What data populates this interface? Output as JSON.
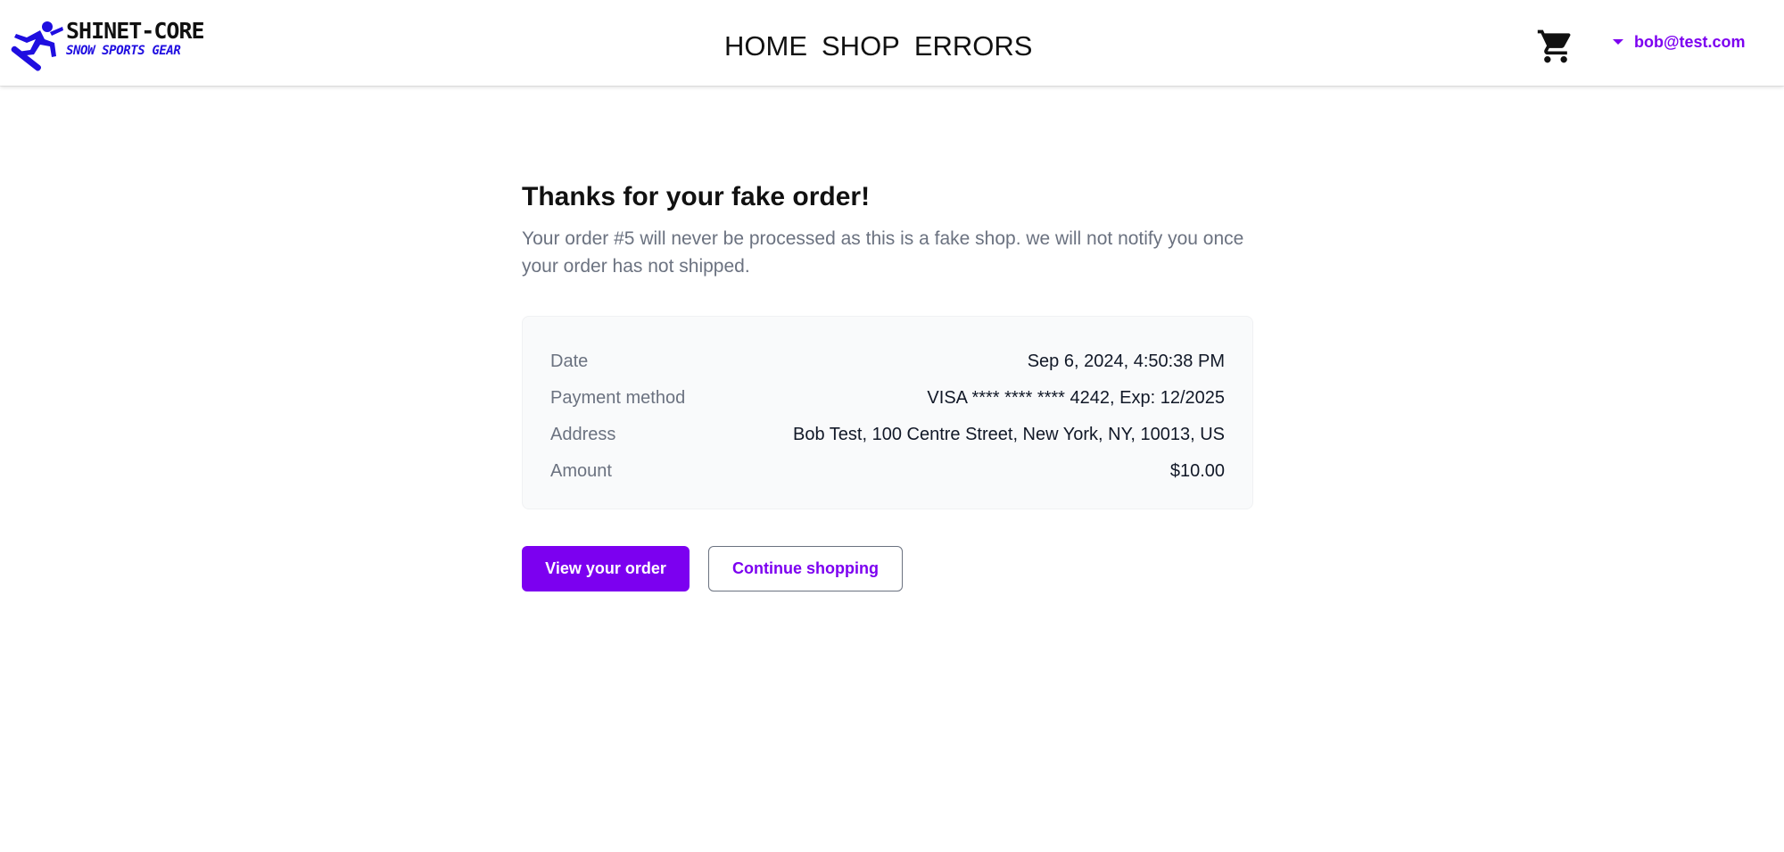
{
  "header": {
    "logo": {
      "title": "SHINET-CORE",
      "subtitle": "SNOW SPORTS GEAR",
      "icon": "snowboarder-icon"
    },
    "nav": [
      "HOME",
      "SHOP",
      "ERRORS"
    ],
    "cart_icon": "cart-icon",
    "user_email": "bob@test.com"
  },
  "confirmation": {
    "heading": "Thanks for your fake order!",
    "message": "Your order #5 will never be processed as this is a fake shop. we will not notify you once your order has not shipped.",
    "details": [
      {
        "label": "Date",
        "value": "Sep 6, 2024, 4:50:38 PM"
      },
      {
        "label": "Payment method",
        "value": "VISA **** **** **** 4242, Exp: 12/2025"
      },
      {
        "label": "Address",
        "value": "Bob Test, 100 Centre Street, New York, NY, 10013, US"
      },
      {
        "label": "Amount",
        "value": "$10.00"
      }
    ],
    "buttons": {
      "view_order": "View your order",
      "continue_shopping": "Continue shopping"
    }
  },
  "colors": {
    "accent": "#7c00f0",
    "logo_blue": "#1f0ee0"
  }
}
